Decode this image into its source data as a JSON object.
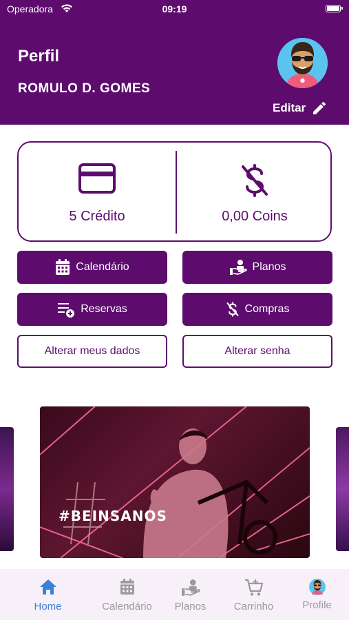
{
  "status_bar": {
    "carrier": "Operadora",
    "time": "09:19"
  },
  "header": {
    "title": "Perfil",
    "user_name": "ROMULO D. GOMES",
    "edit_label": "Editar"
  },
  "balance": {
    "credits": "5 Crédito",
    "coins": "0,00 Coins"
  },
  "actions": {
    "calendar": "Calendário",
    "plans": "Planos",
    "reservations": "Reservas",
    "purchases": "Compras",
    "edit_data": "Alterar meus dados",
    "change_password": "Alterar senha"
  },
  "carousel": {
    "hashtag": "#BEINSANOS"
  },
  "tabbar": {
    "items": [
      {
        "label": "Home",
        "icon": "home-icon",
        "active": true
      },
      {
        "label": "Calendário",
        "icon": "calendar-icon",
        "active": false
      },
      {
        "label": "Planos",
        "icon": "plans-icon",
        "active": false
      },
      {
        "label": "Carrinho",
        "icon": "cart-icon",
        "active": false
      },
      {
        "label": "Profile",
        "icon": "avatar",
        "active": false
      }
    ]
  },
  "colors": {
    "primary": "#5d0c6e",
    "tab_active": "#3b82d6",
    "tab_inactive": "#9a9a9a",
    "tabbar_bg": "#f7f0f8"
  }
}
